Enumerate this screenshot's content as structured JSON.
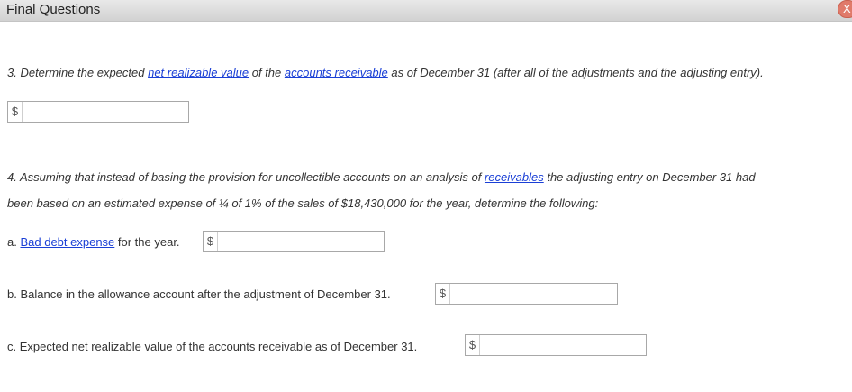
{
  "window": {
    "title": "Final Questions",
    "close_label": "X"
  },
  "q3": {
    "part1": "3. Determine the expected ",
    "link1": "net realizable value",
    "part2": " of the ",
    "link2": "accounts receivable",
    "part3": " as of December 31 (after all of the adjustments and the adjusting entry).",
    "currency": "$",
    "value": ""
  },
  "q4": {
    "line1_part1": "4. Assuming that instead of basing the provision for uncollectible accounts on an analysis of ",
    "line1_link": "receivables",
    "line1_part2": " the adjusting entry on December 31 had",
    "line2": "been based on an estimated expense of ¼ of 1% of the sales of $18,430,000 for the year, determine the following:",
    "a": {
      "prefix": "a. ",
      "link": "Bad debt expense",
      "suffix": " for the year.",
      "currency": "$",
      "value": ""
    },
    "b": {
      "label": "b. Balance in the allowance account after the adjustment of December 31.",
      "currency": "$",
      "value": ""
    },
    "c": {
      "label": "c. Expected net realizable value of the accounts receivable as of December 31.",
      "currency": "$",
      "value": ""
    }
  }
}
